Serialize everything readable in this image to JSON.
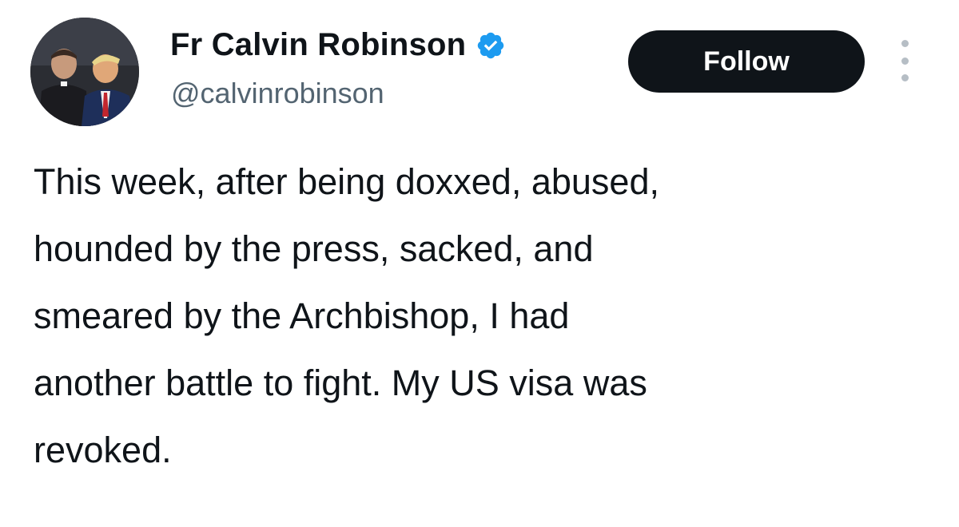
{
  "author": {
    "display_name": "Fr Calvin Robinson",
    "handle": "@calvinrobinson",
    "verified_color": "#1d9bf0"
  },
  "actions": {
    "follow_label": "Follow",
    "more_icon": "more-vertical-icon"
  },
  "tweet": {
    "lines": [
      "This week, after being doxxed, abused,",
      "hounded by the press, sacked, and",
      "smeared by the Archbishop, I had",
      "another battle to fight. My US visa was",
      "revoked."
    ]
  },
  "colors": {
    "text": "#0f1419",
    "secondary_text": "#536471",
    "button_bg": "#0f1419",
    "button_text": "#ffffff"
  }
}
